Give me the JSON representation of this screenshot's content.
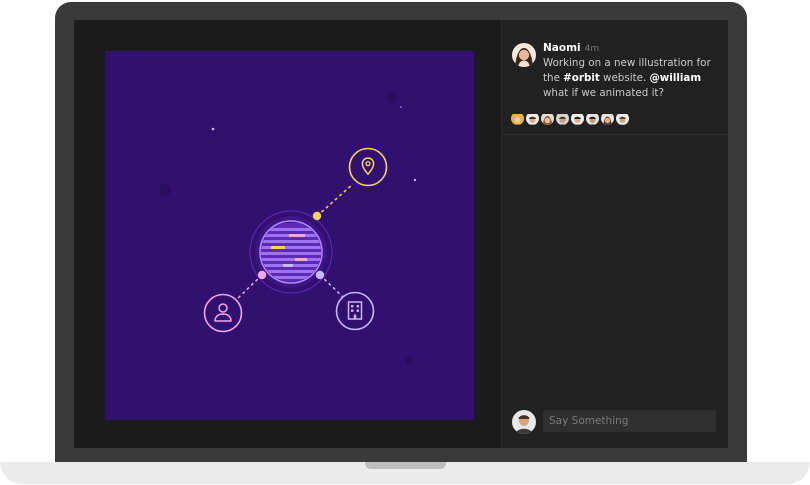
{
  "post": {
    "author": "Naomi",
    "time": "4m",
    "text_part1": "Working on a new illustration for the ",
    "channel": "#orbit",
    "text_part2": " website. ",
    "mention": "@william",
    "text_part3": " what if we animated it?"
  },
  "reactions": {
    "count": 8,
    "avatars": [
      "avatar-1",
      "avatar-2",
      "avatar-3",
      "avatar-4",
      "avatar-5",
      "avatar-6",
      "avatar-7",
      "avatar-8"
    ]
  },
  "composer": {
    "placeholder": "Say Something"
  },
  "illustration": {
    "icons": [
      "location-pin-icon",
      "user-icon",
      "building-icon"
    ],
    "colors": {
      "background": "#32106f",
      "accent_yellow": "#f8d35c",
      "accent_pink": "#f0a7ee",
      "accent_lavender": "#b9a4f2"
    }
  }
}
